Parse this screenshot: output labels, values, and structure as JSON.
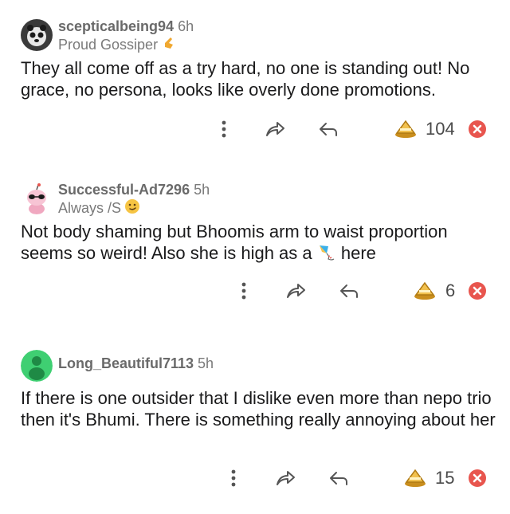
{
  "comments": [
    {
      "username": "scepticalbeing94",
      "age": "6h",
      "flair": "Proud Gossiper",
      "flair_icon": "gold-finger-icon",
      "text": "They all come off as a try hard, no one is standing out! No grace, no persona, looks like overly done promotions.",
      "score": "104",
      "avatar_icon": "panda-avatar"
    },
    {
      "username": "Successful-Ad7296",
      "age": "5h",
      "flair": "Always /S",
      "flair_icon": "smirk-emoji-icon",
      "text_before": "Not body shaming but Bhoomis arm to waist proportion seems so weird! Also she is high as a",
      "text_after": "here",
      "inline_icon": "kite-icon",
      "score": "6",
      "avatar_icon": "snoo-avatar-pink"
    },
    {
      "username": "Long_Beautiful7113",
      "age": "5h",
      "text": "If there is one outsider that I dislike even more than nepo trio then it's Bhumi. There is something really annoying about her",
      "score": "15",
      "avatar_icon": "snoo-avatar-green"
    }
  ],
  "colors": {
    "text": "#1a1a1b",
    "meta": "#7a7a7a",
    "downvote": "#e8554e",
    "upvote": "#e8b84a"
  }
}
